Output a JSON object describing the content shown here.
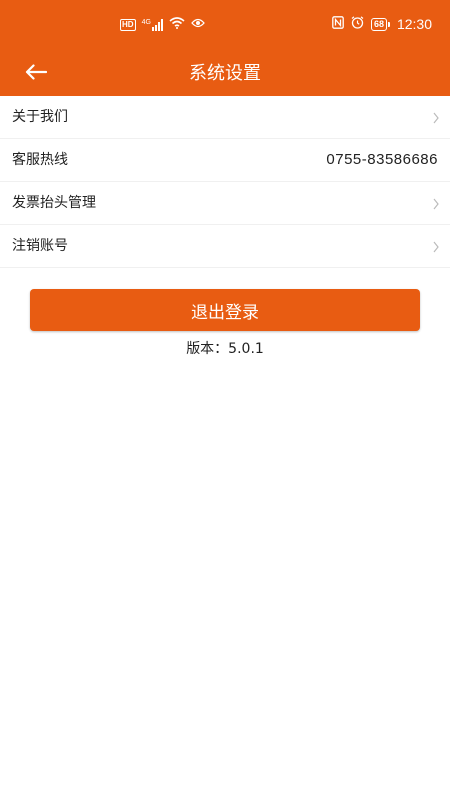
{
  "status_bar": {
    "network_badge": "HD",
    "network_type": "4G",
    "battery_level": "68",
    "time": "12:30"
  },
  "nav": {
    "title": "系统设置"
  },
  "settings": {
    "items": [
      {
        "label": "关于我们",
        "value": "",
        "chevron": true
      },
      {
        "label": "客服热线",
        "value": "0755-83586686",
        "chevron": false
      },
      {
        "label": "发票抬头管理",
        "value": "",
        "chevron": true
      },
      {
        "label": "注销账号",
        "value": "",
        "chevron": true
      }
    ]
  },
  "logout": {
    "label": "退出登录"
  },
  "version": {
    "text": "版本：5.0.1"
  },
  "colors": {
    "accent": "#e85c12"
  }
}
